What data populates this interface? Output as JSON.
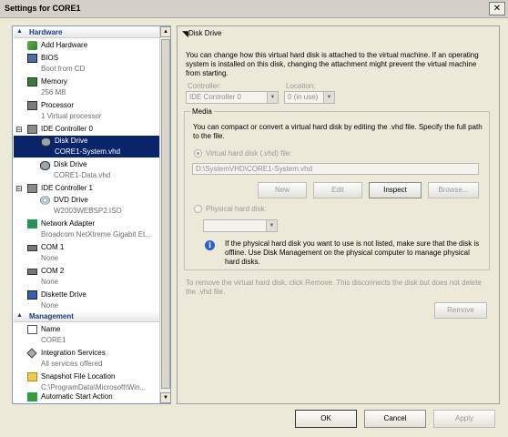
{
  "window": {
    "title": "Settings for CORE1",
    "close_glyph": "✕"
  },
  "tree": {
    "hardware_header": "Hardware",
    "management_header": "Management",
    "items": [
      {
        "label": "Add Hardware",
        "sub": ""
      },
      {
        "label": "BIOS",
        "sub": "Boot from CD"
      },
      {
        "label": "Memory",
        "sub": "256 MB"
      },
      {
        "label": "Processor",
        "sub": "1 Virtual processor"
      },
      {
        "label": "IDE Controller 0",
        "sub": ""
      },
      {
        "label": "Disk Drive",
        "sub": "CORE1-System.vhd"
      },
      {
        "label": "Disk Drive",
        "sub": "CORE1-Data.vhd"
      },
      {
        "label": "IDE Controller 1",
        "sub": ""
      },
      {
        "label": "DVD Drive",
        "sub": "W2003WEBSP2.ISO"
      },
      {
        "label": "Network Adapter",
        "sub": "Broadcom NetXtreme Gigabit Et..."
      },
      {
        "label": "COM 1",
        "sub": "None"
      },
      {
        "label": "COM 2",
        "sub": "None"
      },
      {
        "label": "Diskette Drive",
        "sub": "None"
      },
      {
        "label": "Name",
        "sub": "CORE1"
      },
      {
        "label": "Integration Services",
        "sub": "All services offered"
      },
      {
        "label": "Snapshot File Location",
        "sub": "C:\\ProgramData\\Microsoft\\Win..."
      },
      {
        "label": "Automatic Start Action",
        "sub": ""
      }
    ]
  },
  "panel": {
    "header": "Disk Drive",
    "description": "You can change how this virtual hard disk is attached to the virtual machine. If an operating system is installed on this disk, changing the attachment might prevent the virtual machine from starting.",
    "controller_label": "Controller:",
    "controller_value": "IDE Controller 0",
    "location_label": "Location:",
    "location_value": "0 (in use)",
    "media_label": "Media",
    "media_desc": "You can compact or convert a virtual hard disk by editing the .vhd file. Specify the full path to the file.",
    "vhd_radio_label": "Virtual hard disk (.vhd) file:",
    "vhd_path": "D:\\SystemVHD\\CORE1-System.vhd",
    "new_label": "New",
    "edit_label": "Edit",
    "inspect_label": "Inspect",
    "browse_label": "Browse...",
    "physical_radio_label": "Physical hard disk:",
    "physical_value": "",
    "info_glyph": "i",
    "info_text": "If the physical hard disk you want to use is not listed, make sure that the disk is offline. Use Disk Management on the physical computer to manage physical hard disks.",
    "remove_text": "To remove the virtual hard disk, click Remove. This disconnects the disk but does not delete the .vhd file.",
    "remove_label": "Remove"
  },
  "footer": {
    "ok_label": "OK",
    "cancel_label": "Cancel",
    "apply_label": "Apply"
  },
  "icons": [
    "close-icon",
    "chevron-up-icon",
    "add-hardware-icon",
    "bios-chip-icon",
    "memory-icon",
    "processor-icon",
    "ide-controller-icon",
    "disk-drive-icon",
    "dvd-drive-icon",
    "network-adapter-icon",
    "com-port-icon",
    "diskette-drive-icon",
    "name-icon",
    "integration-services-icon",
    "snapshot-folder-icon",
    "automatic-start-icon",
    "info-icon"
  ]
}
